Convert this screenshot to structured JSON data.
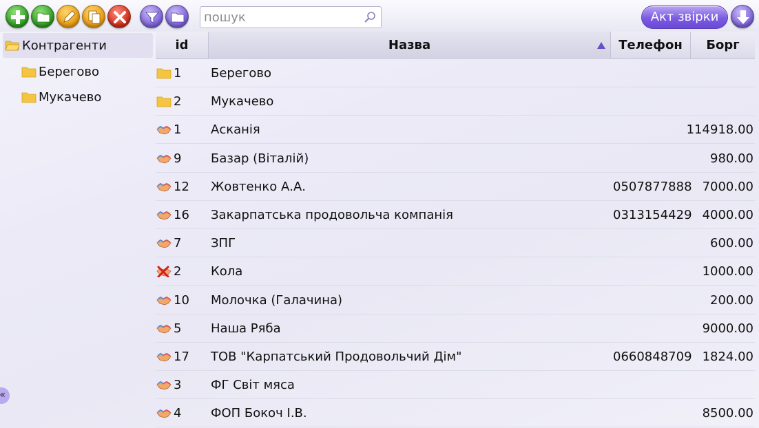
{
  "toolbar": {
    "buttons": [
      {
        "name": "add",
        "icon": "plus-icon",
        "color": "#2c9a1e"
      },
      {
        "name": "add-folder",
        "icon": "folder-icon",
        "color": "#2c9a1e"
      },
      {
        "name": "edit",
        "icon": "pencil-icon",
        "color": "#e89a10"
      },
      {
        "name": "copy",
        "icon": "copy-icon",
        "color": "#e89a10"
      },
      {
        "name": "delete",
        "icon": "x-icon",
        "color": "#cf2a16"
      },
      {
        "name": "filter",
        "icon": "funnel-icon",
        "color": "#7a5fd8"
      },
      {
        "name": "open-folder",
        "icon": "folder-icon",
        "color": "#7a5fd8"
      }
    ],
    "search_placeholder": "пошук",
    "act_label": "Акт звірки",
    "accent": "#7b5ce0"
  },
  "tree": {
    "root": "Контрагенти",
    "children": [
      "Берегово",
      "Мукачево"
    ],
    "collapse": "«"
  },
  "grid": {
    "columns": {
      "id": "id",
      "name": "Назва",
      "phone": "Телефон",
      "debt": "Борг"
    },
    "sort": {
      "column": "Назва",
      "direction": "asc"
    },
    "rows": [
      {
        "type": "folder",
        "id": "1",
        "name": "Берегово",
        "phone": "",
        "debt": ""
      },
      {
        "type": "folder",
        "id": "2",
        "name": "Мукачево",
        "phone": "",
        "debt": ""
      },
      {
        "type": "partner",
        "id": "1",
        "name": "Асканія",
        "phone": "",
        "debt": "114918.00"
      },
      {
        "type": "partner",
        "id": "9",
        "name": "Базар (Віталій)",
        "phone": "",
        "debt": "980.00"
      },
      {
        "type": "partner",
        "id": "12",
        "name": "Жовтенко А.А.",
        "phone": "0507877888",
        "debt": "7000.00"
      },
      {
        "type": "partner",
        "id": "16",
        "name": "Закарпатська продовольча компанія",
        "phone": "0313154429",
        "debt": "4000.00"
      },
      {
        "type": "partner",
        "id": "7",
        "name": "ЗПГ",
        "phone": "",
        "debt": "600.00"
      },
      {
        "type": "partner-inactive",
        "id": "2",
        "name": "Кола",
        "phone": "",
        "debt": "1000.00"
      },
      {
        "type": "partner",
        "id": "10",
        "name": "Молочка (Галачина)",
        "phone": "",
        "debt": "200.00"
      },
      {
        "type": "partner",
        "id": "5",
        "name": "Наша Ряба",
        "phone": "",
        "debt": "9000.00"
      },
      {
        "type": "partner",
        "id": "17",
        "name": "ТОВ \"Карпатський Продовольчий Дім\"",
        "phone": "0660848709",
        "debt": "1824.00"
      },
      {
        "type": "partner",
        "id": "3",
        "name": "ФГ Світ мяса",
        "phone": "",
        "debt": ""
      },
      {
        "type": "partner",
        "id": "4",
        "name": "ФОП Бокоч І.В.",
        "phone": "",
        "debt": "8500.00"
      }
    ]
  }
}
